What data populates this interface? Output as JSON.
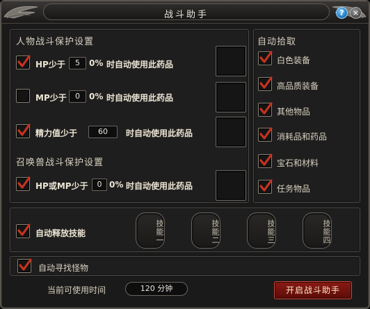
{
  "window": {
    "title": "战斗助手",
    "help_glyph": "?",
    "close_glyph": "×"
  },
  "player_protection": {
    "title": "人物战斗保护设置",
    "rows": [
      {
        "checked": true,
        "prefix": "HP少于",
        "value": "5",
        "suffix": "0%",
        "action": "时自动使用此药品"
      },
      {
        "checked": false,
        "prefix": "MP少于",
        "value": "0",
        "suffix": "0%",
        "action": "时自动使用此药品"
      },
      {
        "checked": true,
        "prefix": "精力值少于",
        "value": "60",
        "suffix": "",
        "action": "时自动使用此药品"
      }
    ]
  },
  "summon_protection": {
    "title": "召唤兽战斗保护设置",
    "row": {
      "checked": true,
      "prefix": "HP或MP少于",
      "value": "0",
      "suffix": "0%",
      "action": "时自动使用此药品"
    }
  },
  "auto_pickup": {
    "title": "自动拾取",
    "items": [
      {
        "label": "白色装备",
        "checked": true
      },
      {
        "label": "高品质装备",
        "checked": true
      },
      {
        "label": "其他物品",
        "checked": true
      },
      {
        "label": "消耗品和药品",
        "checked": true
      },
      {
        "label": "宝石和材料",
        "checked": true
      },
      {
        "label": "任务物品",
        "checked": true
      }
    ]
  },
  "skills": {
    "auto_release_label": "自动释放技能",
    "auto_release_checked": true,
    "slots": [
      "技能一",
      "技能二",
      "技能三",
      "技能四"
    ]
  },
  "auto_find": {
    "label": "自动寻找怪物",
    "checked": true
  },
  "footer": {
    "time_label": "当前可使用时间",
    "time_value": "120 分钟",
    "start_button": "开启战斗助手"
  },
  "colors": {
    "check_red": "#c8321e",
    "start_button_red": "#7a1610",
    "help_blue": "#1a70b8"
  }
}
